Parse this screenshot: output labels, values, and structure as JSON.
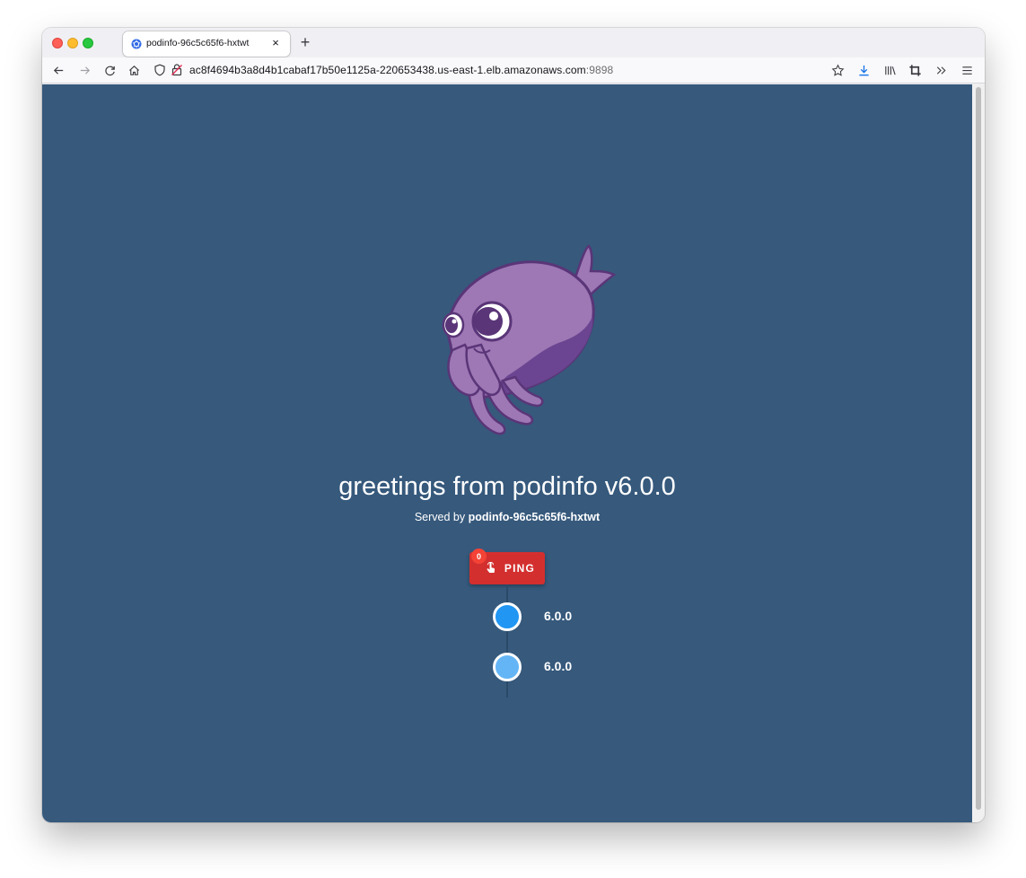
{
  "browser": {
    "tab": {
      "title": "podinfo-96c5c65f6-hxtwt",
      "close_label": "×",
      "favicon": "kubernetes-icon"
    },
    "new_tab_label": "+",
    "url": {
      "host": "ac8f4694b3a8d4b1cabaf17b50e1125a-220653438.us-east-1.elb.amazonaws.com",
      "port": ":9898"
    },
    "colors": {
      "accent_download": "#1a73e8"
    }
  },
  "page": {
    "background": "#36597c",
    "greeting": "greetings from podinfo v6.0.0",
    "served_prefix": "Served by ",
    "served_host": "podinfo-96c5c65f6-hxtwt",
    "ping": {
      "label": "PING",
      "count": "0",
      "color": "#d32f2f"
    },
    "timeline": [
      {
        "version": "6.0.0",
        "color": "#2196f3"
      },
      {
        "version": "6.0.0",
        "color": "#64b5f6"
      }
    ]
  }
}
